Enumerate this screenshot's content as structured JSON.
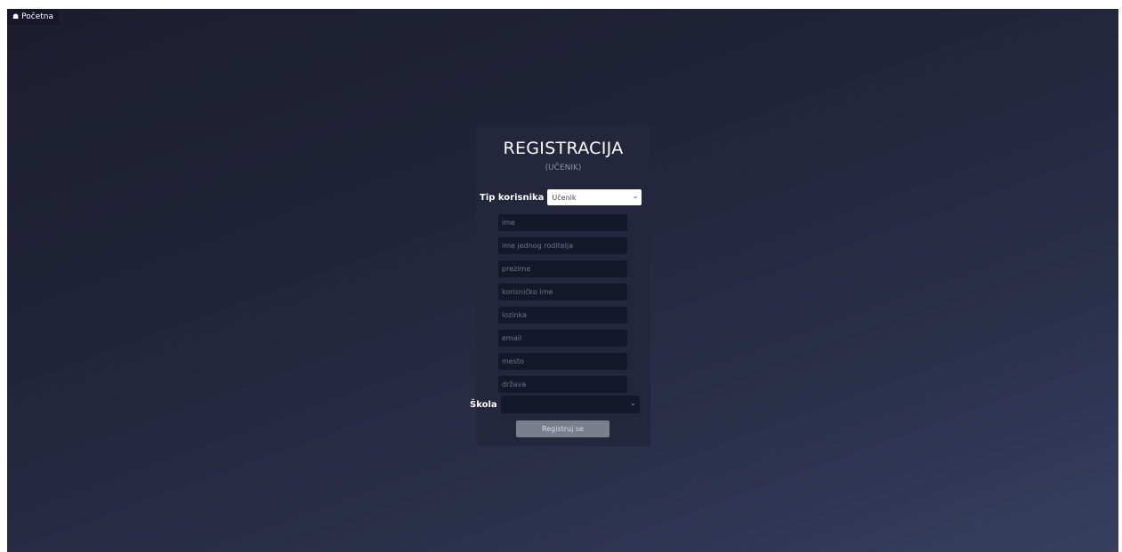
{
  "nav": {
    "home_icon": "home-icon",
    "home_label": "Početna"
  },
  "form": {
    "title": "REGISTRACIJA",
    "subtitle": "(UČENIK)",
    "user_type_label": "Tip korisnika",
    "user_type_value": "Učenik",
    "fields": [
      {
        "placeholder": "ime",
        "value": ""
      },
      {
        "placeholder": "ime jednog roditelja",
        "value": ""
      },
      {
        "placeholder": "prezime",
        "value": ""
      },
      {
        "placeholder": "korisničko ime",
        "value": ""
      },
      {
        "placeholder": "lozinka",
        "value": ""
      },
      {
        "placeholder": "email",
        "value": ""
      },
      {
        "placeholder": "mesto",
        "value": ""
      },
      {
        "placeholder": "država",
        "value": ""
      }
    ],
    "school_label": "Škola",
    "school_value": "",
    "submit_label": "Registruj se"
  },
  "colors": {
    "background_top": "#1c1d2f",
    "background_bottom": "#36405f",
    "card": "#24273b",
    "input": "#15182a",
    "submit": "#7a7e8d"
  }
}
